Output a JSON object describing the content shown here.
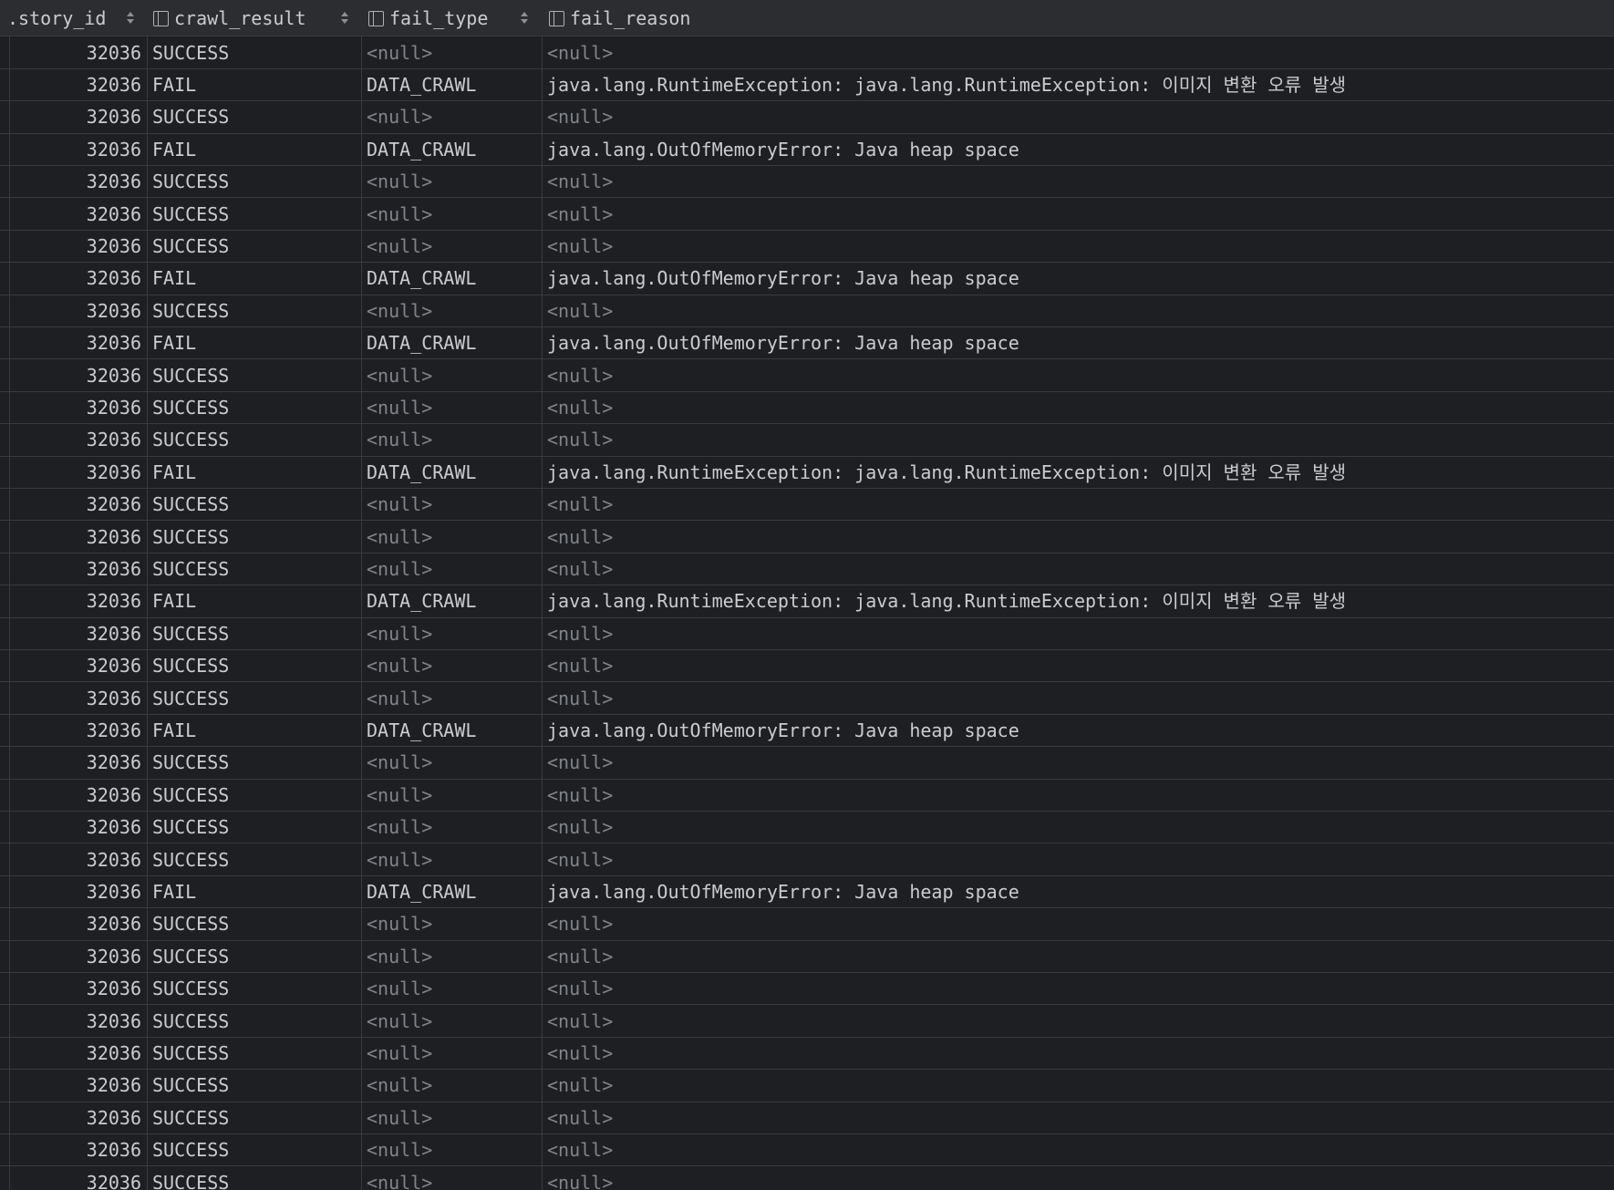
{
  "columns": [
    {
      "label": ".story_id",
      "has_col_icon": false,
      "has_sort": true
    },
    {
      "label": "crawl_result",
      "has_col_icon": true,
      "has_sort": true
    },
    {
      "label": "fail_type",
      "has_col_icon": true,
      "has_sort": true
    },
    {
      "label": "fail_reason",
      "has_col_icon": true,
      "has_sort": false
    }
  ],
  "null_text": "<null>",
  "rows": [
    {
      "story_id": "32036",
      "crawl_result": "SUCCESS",
      "fail_type": null,
      "fail_reason": null
    },
    {
      "story_id": "32036",
      "crawl_result": "FAIL",
      "fail_type": "DATA_CRAWL",
      "fail_reason": "java.lang.RuntimeException: java.lang.RuntimeException: 이미지 변환 오류 발생"
    },
    {
      "story_id": "32036",
      "crawl_result": "SUCCESS",
      "fail_type": null,
      "fail_reason": null
    },
    {
      "story_id": "32036",
      "crawl_result": "FAIL",
      "fail_type": "DATA_CRAWL",
      "fail_reason": "java.lang.OutOfMemoryError: Java heap space"
    },
    {
      "story_id": "32036",
      "crawl_result": "SUCCESS",
      "fail_type": null,
      "fail_reason": null
    },
    {
      "story_id": "32036",
      "crawl_result": "SUCCESS",
      "fail_type": null,
      "fail_reason": null
    },
    {
      "story_id": "32036",
      "crawl_result": "SUCCESS",
      "fail_type": null,
      "fail_reason": null
    },
    {
      "story_id": "32036",
      "crawl_result": "FAIL",
      "fail_type": "DATA_CRAWL",
      "fail_reason": "java.lang.OutOfMemoryError: Java heap space"
    },
    {
      "story_id": "32036",
      "crawl_result": "SUCCESS",
      "fail_type": null,
      "fail_reason": null
    },
    {
      "story_id": "32036",
      "crawl_result": "FAIL",
      "fail_type": "DATA_CRAWL",
      "fail_reason": "java.lang.OutOfMemoryError: Java heap space"
    },
    {
      "story_id": "32036",
      "crawl_result": "SUCCESS",
      "fail_type": null,
      "fail_reason": null
    },
    {
      "story_id": "32036",
      "crawl_result": "SUCCESS",
      "fail_type": null,
      "fail_reason": null
    },
    {
      "story_id": "32036",
      "crawl_result": "SUCCESS",
      "fail_type": null,
      "fail_reason": null
    },
    {
      "story_id": "32036",
      "crawl_result": "FAIL",
      "fail_type": "DATA_CRAWL",
      "fail_reason": "java.lang.RuntimeException: java.lang.RuntimeException: 이미지 변환 오류 발생"
    },
    {
      "story_id": "32036",
      "crawl_result": "SUCCESS",
      "fail_type": null,
      "fail_reason": null
    },
    {
      "story_id": "32036",
      "crawl_result": "SUCCESS",
      "fail_type": null,
      "fail_reason": null
    },
    {
      "story_id": "32036",
      "crawl_result": "SUCCESS",
      "fail_type": null,
      "fail_reason": null
    },
    {
      "story_id": "32036",
      "crawl_result": "FAIL",
      "fail_type": "DATA_CRAWL",
      "fail_reason": "java.lang.RuntimeException: java.lang.RuntimeException: 이미지 변환 오류 발생"
    },
    {
      "story_id": "32036",
      "crawl_result": "SUCCESS",
      "fail_type": null,
      "fail_reason": null
    },
    {
      "story_id": "32036",
      "crawl_result": "SUCCESS",
      "fail_type": null,
      "fail_reason": null
    },
    {
      "story_id": "32036",
      "crawl_result": "SUCCESS",
      "fail_type": null,
      "fail_reason": null
    },
    {
      "story_id": "32036",
      "crawl_result": "FAIL",
      "fail_type": "DATA_CRAWL",
      "fail_reason": "java.lang.OutOfMemoryError: Java heap space"
    },
    {
      "story_id": "32036",
      "crawl_result": "SUCCESS",
      "fail_type": null,
      "fail_reason": null
    },
    {
      "story_id": "32036",
      "crawl_result": "SUCCESS",
      "fail_type": null,
      "fail_reason": null
    },
    {
      "story_id": "32036",
      "crawl_result": "SUCCESS",
      "fail_type": null,
      "fail_reason": null
    },
    {
      "story_id": "32036",
      "crawl_result": "SUCCESS",
      "fail_type": null,
      "fail_reason": null
    },
    {
      "story_id": "32036",
      "crawl_result": "FAIL",
      "fail_type": "DATA_CRAWL",
      "fail_reason": "java.lang.OutOfMemoryError: Java heap space"
    },
    {
      "story_id": "32036",
      "crawl_result": "SUCCESS",
      "fail_type": null,
      "fail_reason": null
    },
    {
      "story_id": "32036",
      "crawl_result": "SUCCESS",
      "fail_type": null,
      "fail_reason": null
    },
    {
      "story_id": "32036",
      "crawl_result": "SUCCESS",
      "fail_type": null,
      "fail_reason": null
    },
    {
      "story_id": "32036",
      "crawl_result": "SUCCESS",
      "fail_type": null,
      "fail_reason": null
    },
    {
      "story_id": "32036",
      "crawl_result": "SUCCESS",
      "fail_type": null,
      "fail_reason": null
    },
    {
      "story_id": "32036",
      "crawl_result": "SUCCESS",
      "fail_type": null,
      "fail_reason": null
    },
    {
      "story_id": "32036",
      "crawl_result": "SUCCESS",
      "fail_type": null,
      "fail_reason": null
    },
    {
      "story_id": "32036",
      "crawl_result": "SUCCESS",
      "fail_type": null,
      "fail_reason": null
    },
    {
      "story_id": "32036",
      "crawl_result": "SUCCESS",
      "fail_type": null,
      "fail_reason": null
    }
  ]
}
